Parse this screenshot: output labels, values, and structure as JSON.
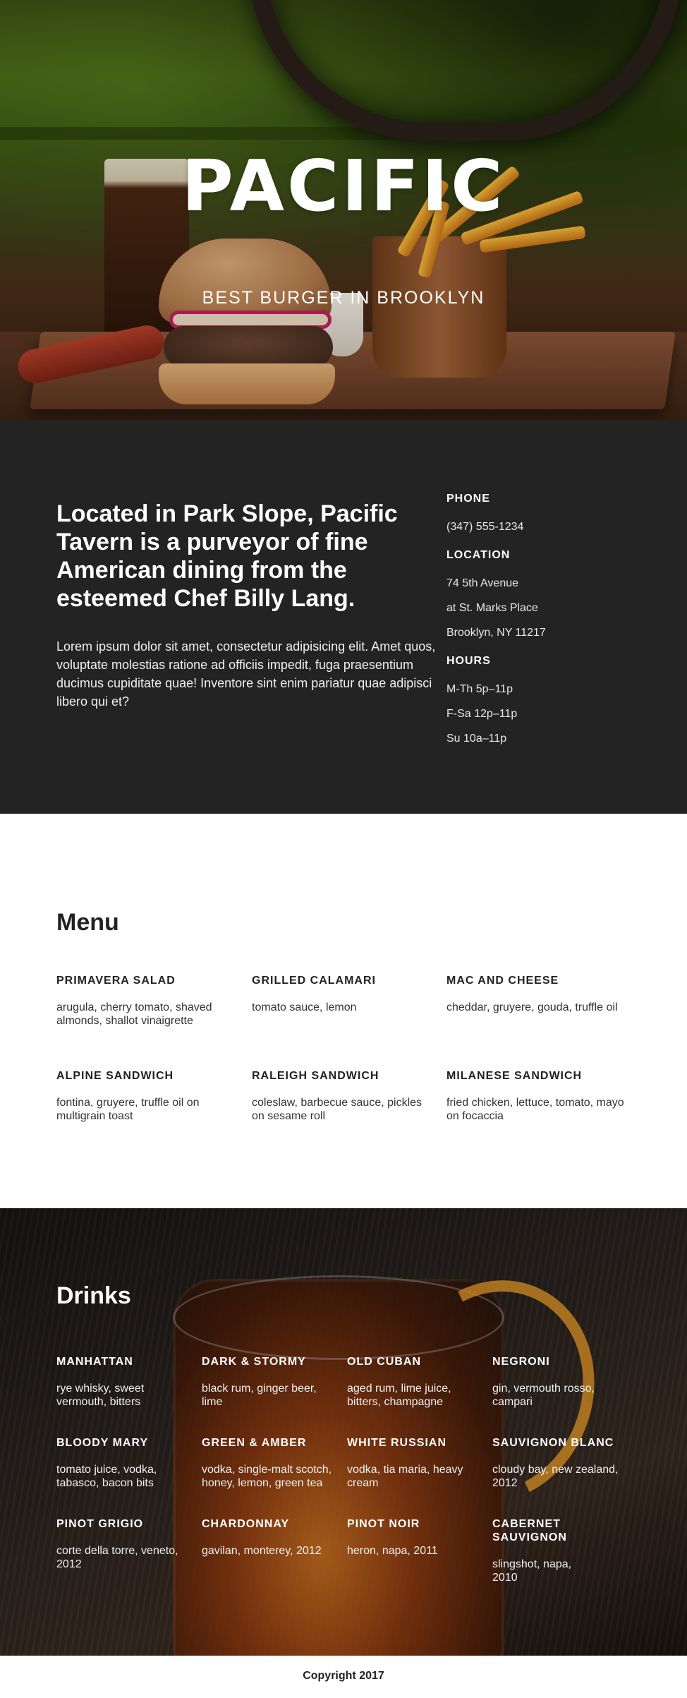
{
  "hero": {
    "title": "PACIFIC",
    "tagline": "BEST BURGER IN BROOKLYN"
  },
  "about": {
    "headline": "Located in Park Slope, Pacific Tavern is a purveyor of fine American dining from the esteemed Chef Billy Lang.",
    "body": "Lorem ipsum dolor sit amet, consectetur adipisicing elit. Amet quos, voluptate molestias ratione ad officiis impedit, fuga praesentium ducimus cupiditate quae! Inventore sint enim pariatur quae adipisci libero qui et?",
    "phone_label": "PHONE",
    "phone": "(347) 555-1234",
    "location_label": "LOCATION",
    "location_lines": [
      "74 5th Avenue",
      "at St. Marks Place",
      "Brooklyn, NY 11217"
    ],
    "hours_label": "HOURS",
    "hours_lines": [
      "M-Th 5p–11p",
      "F-Sa 12p–11p",
      "Su 10a–11p"
    ]
  },
  "menu": {
    "title": "Menu",
    "items": [
      {
        "name": "PRIMAVERA SALAD",
        "desc": "arugula, cherry tomato, shaved almonds, shallot vinaigrette"
      },
      {
        "name": "GRILLED CALAMARI",
        "desc": "tomato sauce, lemon"
      },
      {
        "name": "MAC AND CHEESE",
        "desc": "cheddar, gruyere, gouda, truffle oil"
      },
      {
        "name": "ALPINE SANDWICH",
        "desc": "fontina, gruyere, truffle oil on multigrain toast"
      },
      {
        "name": "RALEIGH SANDWICH",
        "desc": "coleslaw, barbecue sauce, pickles on sesame roll"
      },
      {
        "name": "MILANESE SANDWICH",
        "desc": "fried chicken, lettuce, tomato, mayo on focaccia"
      }
    ]
  },
  "drinks": {
    "title": "Drinks",
    "items": [
      {
        "name": "MANHATTAN",
        "desc": "rye whisky, sweet vermouth, bitters"
      },
      {
        "name": "DARK & STORMY",
        "desc": "black rum, ginger beer, lime"
      },
      {
        "name": "OLD CUBAN",
        "desc": "aged rum, lime juice, bitters, champagne"
      },
      {
        "name": "NEGRONI",
        "desc": "gin, vermouth rosso, campari"
      },
      {
        "name": "BLOODY MARY",
        "desc": "tomato juice, vodka, tabasco, bacon bits"
      },
      {
        "name": "GREEN & AMBER",
        "desc": "vodka, single-malt scotch, honey, lemon, green tea"
      },
      {
        "name": "WHITE RUSSIAN",
        "desc": "vodka, tia maria, heavy cream"
      },
      {
        "name": "SAUVIGNON BLANC",
        "desc": "cloudy bay, new zealand, 2012"
      },
      {
        "name": "PINOT GRIGIO",
        "desc": "corte della torre, veneto, 2012"
      },
      {
        "name": "CHARDONNAY",
        "desc": "gavilan, monterey, 2012"
      },
      {
        "name": "PINOT NOIR",
        "desc": "heron, napa, 2011"
      },
      {
        "name": "CABERNET SAUVIGNON",
        "desc": "slingshot, napa, 2010"
      }
    ]
  },
  "footer": {
    "copyright": "Copyright 2017"
  }
}
